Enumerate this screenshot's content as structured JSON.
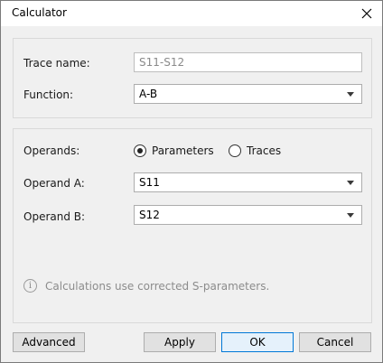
{
  "window": {
    "title": "Calculator"
  },
  "trace_group": {
    "trace_name_label": "Trace name:",
    "trace_name_value": "S11-S12",
    "function_label": "Function:",
    "function_value": "A-B"
  },
  "operands_group": {
    "operands_label": "Operands:",
    "radio_parameters": "Parameters",
    "radio_traces": "Traces",
    "selected": "Parameters",
    "operand_a_label": "Operand A:",
    "operand_a_value": "S11",
    "operand_b_label": "Operand B:",
    "operand_b_value": "S12",
    "info_text": "Calculations use corrected S-parameters."
  },
  "buttons": {
    "advanced": "Advanced",
    "apply": "Apply",
    "ok": "OK",
    "cancel": "Cancel"
  },
  "icons": {
    "close": "close-icon",
    "info": "info-icon",
    "dropdown": "chevron-down-icon"
  },
  "colors": {
    "default_button_border": "#0078d7",
    "window_bg": "#f0f0f0"
  }
}
